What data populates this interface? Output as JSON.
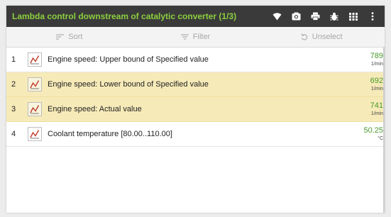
{
  "window": {
    "title": "Lambda control downstream of catalytic converter (1/3)"
  },
  "titlebar_icons": [
    "wifi-icon",
    "camera-icon",
    "print-icon",
    "bug-icon",
    "grid-icon",
    "more-vert-icon"
  ],
  "toolbar": {
    "sort_label": "Sort",
    "filter_label": "Filter",
    "unselect_label": "Unselect"
  },
  "rows": [
    {
      "index": "1",
      "label": "Engine speed: Upper bound of Specified value",
      "value": "789",
      "unit": "1/min",
      "highlighted": false
    },
    {
      "index": "2",
      "label": "Engine speed: Lower bound of Specified value",
      "value": "692",
      "unit": "1/min",
      "highlighted": true
    },
    {
      "index": "3",
      "label": "Engine speed: Actual value",
      "value": "741",
      "unit": "1/min",
      "highlighted": true
    },
    {
      "index": "4",
      "label": "Coolant temperature [80.00..110.00]",
      "value": "50.25",
      "unit": "°C",
      "highlighted": false
    }
  ],
  "colors": {
    "title_text": "#8ccf3f",
    "titlebar_bg": "#3a3a3a",
    "highlight_row": "#f6eab8",
    "value_text": "#4a9a2a"
  }
}
